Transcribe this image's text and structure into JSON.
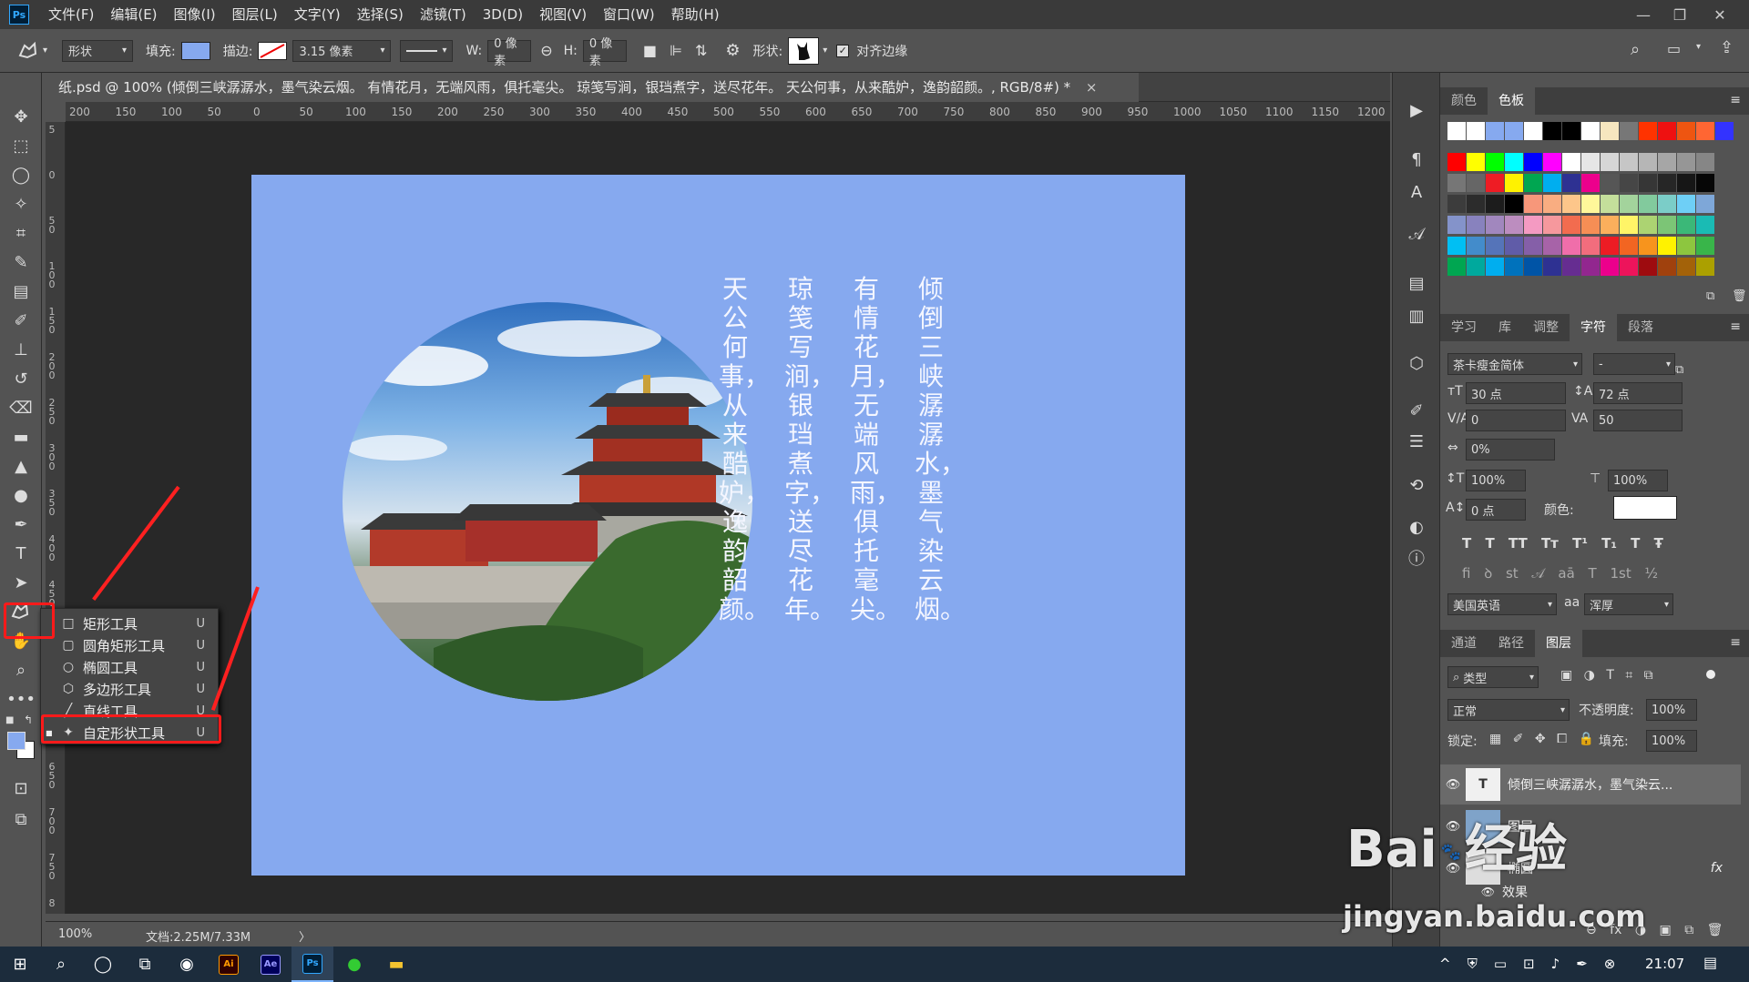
{
  "app": {
    "logo": "Ps"
  },
  "menu": [
    "文件(F)",
    "编辑(E)",
    "图像(I)",
    "图层(L)",
    "文字(Y)",
    "选择(S)",
    "滤镜(T)",
    "3D(D)",
    "视图(V)",
    "窗口(W)",
    "帮助(H)"
  ],
  "window_controls": [
    "—",
    "❐",
    "✕"
  ],
  "options": {
    "mode": "形状",
    "fill_label": "填充:",
    "fill_color": "#86a9ef",
    "stroke_label": "描边:",
    "stroke_width": "3.15 像素",
    "w_label": "W:",
    "w_value": "0 像素",
    "h_label": "H:",
    "h_value": "0 像素",
    "shape_label": "形状:",
    "align_edges": "对齐边缘"
  },
  "document": {
    "tab_title": "纸.psd @ 100% (倾倒三峡潺潺水，墨气染云烟。 有情花月，无端风雨，俱托毫尖。 琼笺写涧，银珰煮字，送尽花年。 天公何事，从来酷妒，逸韵韶颜。, RGB/8#) *",
    "close": "×"
  },
  "ruler_h": [
    "200",
    "150",
    "100",
    "50",
    "0",
    "50",
    "100",
    "150",
    "200",
    "250",
    "300",
    "350",
    "400",
    "450",
    "500",
    "550",
    "600",
    "650",
    "700",
    "750",
    "800",
    "850",
    "900",
    "950",
    "1000",
    "1050",
    "1100",
    "1150",
    "1200"
  ],
  "ruler_v": [
    "5",
    "0",
    "5 0",
    "1 0 0",
    "1 5 0",
    "2 0 0",
    "2 5 0",
    "3 0 0",
    "3 5 0",
    "4 0 0",
    "4 5 0",
    "5 0 0",
    "5 5 0",
    "6 0 0",
    "6 5 0",
    "7 0 0",
    "7 5 0",
    "8"
  ],
  "poem": {
    "col1": "倾倒三峡潺潺水，墨气染云烟。",
    "col2": "有情花月，无端风雨，俱托毫尖。",
    "col3": "琼笺写涧，银珰煮字，送尽花年。",
    "col4": "天公何事，从来酷妒，逸韵韶颜。"
  },
  "status": {
    "zoom": "100%",
    "doc": "文档:2.25M/7.33M",
    "arrow": "〉"
  },
  "flyout": [
    {
      "label": "矩形工具",
      "key": "U",
      "icon": "rectangle-icon"
    },
    {
      "label": "圆角矩形工具",
      "key": "U",
      "icon": "rounded-rect-icon"
    },
    {
      "label": "椭圆工具",
      "key": "U",
      "icon": "ellipse-icon"
    },
    {
      "label": "多边形工具",
      "key": "U",
      "icon": "polygon-icon"
    },
    {
      "label": "直线工具",
      "key": "U",
      "icon": "line-icon"
    },
    {
      "label": "自定形状工具",
      "key": "U",
      "icon": "custom-shape-icon"
    }
  ],
  "swatch_panel": {
    "tabs": [
      "颜色",
      "色板"
    ],
    "active": "色板"
  },
  "char_panel": {
    "tabs": [
      "学习",
      "库",
      "调整",
      "字符",
      "段落"
    ],
    "active": "字符",
    "font": "茶卡瘦金简体",
    "style": "-",
    "size": "30 点",
    "leading": "72 点",
    "kerning": "0",
    "tracking": "50",
    "scale_pct": "0%",
    "vscale": "100%",
    "hscale": "100%",
    "baseline": "0 点",
    "color_label": "颜色:",
    "language": "美国英语",
    "aa_label": "aa",
    "aa": "浑厚"
  },
  "layers_panel": {
    "tabs": [
      "通道",
      "路径",
      "图层"
    ],
    "active": "图层",
    "filter": "类型",
    "blend": "正常",
    "opacity_label": "不透明度:",
    "opacity": "100%",
    "lock_label": "锁定:",
    "fill_label": "填充:",
    "fill": "100%",
    "layers": [
      {
        "name": "倾倒三峡潺潺水，墨气染云..."
      },
      {
        "name": "图层"
      },
      {
        "name": "椭圆"
      },
      {
        "name": "效果"
      }
    ],
    "fx": "fx"
  },
  "taskbar": {
    "time": "21:07",
    "apps": [
      "Ai",
      "Ae",
      "Ps"
    ]
  },
  "watermark": {
    "line1": "Bai",
    "line1b": "经验",
    "line2": "jingyan.baidu.com"
  },
  "colors": {
    "accent_red": "#ff1a1a",
    "canvas": "#86a9ef",
    "swatches_row0": [
      "#ffffff",
      "#ffffff",
      "#86a9ef",
      "#86a9ef",
      "#ffffff",
      "#000000",
      "#000000",
      "#ffffff",
      "#f6e6bf",
      "#777777",
      "#ff3300",
      "#ee1111",
      "#ee5511",
      "#ff6633",
      "#3333ff"
    ],
    "swatches": [
      [
        "#ff0000",
        "#ffff00",
        "#00ff00",
        "#00ffff",
        "#0000ff",
        "#ff00ff",
        "#ffffff",
        "#e6e6e6",
        "#d6d6d6",
        "#c6c6c6",
        "#b6b6b6",
        "#a6a6a6",
        "#969696",
        "#868686"
      ],
      [
        "#767676",
        "#666666",
        "#ee1c24",
        "#fff200",
        "#00a651",
        "#00aeef",
        "#2e3192",
        "#ec008c",
        "#565656",
        "#464646",
        "#363636",
        "#262626",
        "#161616",
        "#060606"
      ],
      [
        "#3c3c3c",
        "#2c2c2c",
        "#1c1c1c",
        "#000000",
        "#f7977a",
        "#f9ad81",
        "#fdc68a",
        "#fff79a",
        "#c4df9b",
        "#a3d39c",
        "#82ca9d",
        "#7bcdc8",
        "#6ecff6",
        "#7ea7d8"
      ],
      [
        "#8493ca",
        "#8882be",
        "#a187be",
        "#bc8dbf",
        "#f49ac2",
        "#f6989d",
        "#f26c4f",
        "#f68e55",
        "#fbaf5c",
        "#fff467",
        "#acd372",
        "#7cc576",
        "#3bb878",
        "#1abbb4"
      ],
      [
        "#00bff3",
        "#438ccb",
        "#5574b9",
        "#605ca8",
        "#855fa8",
        "#a763a8",
        "#f06eaa",
        "#f26d7d",
        "#ed1c24",
        "#f26522",
        "#f7941d",
        "#fff200",
        "#8dc63f",
        "#39b54a"
      ],
      [
        "#00a651",
        "#00a99d",
        "#00aeef",
        "#0072bc",
        "#0054a6",
        "#2e3192",
        "#662d91",
        "#92278f",
        "#ec008c",
        "#ed145b",
        "#9e0b0f",
        "#a0410d",
        "#a36209",
        "#aba000"
      ]
    ]
  }
}
